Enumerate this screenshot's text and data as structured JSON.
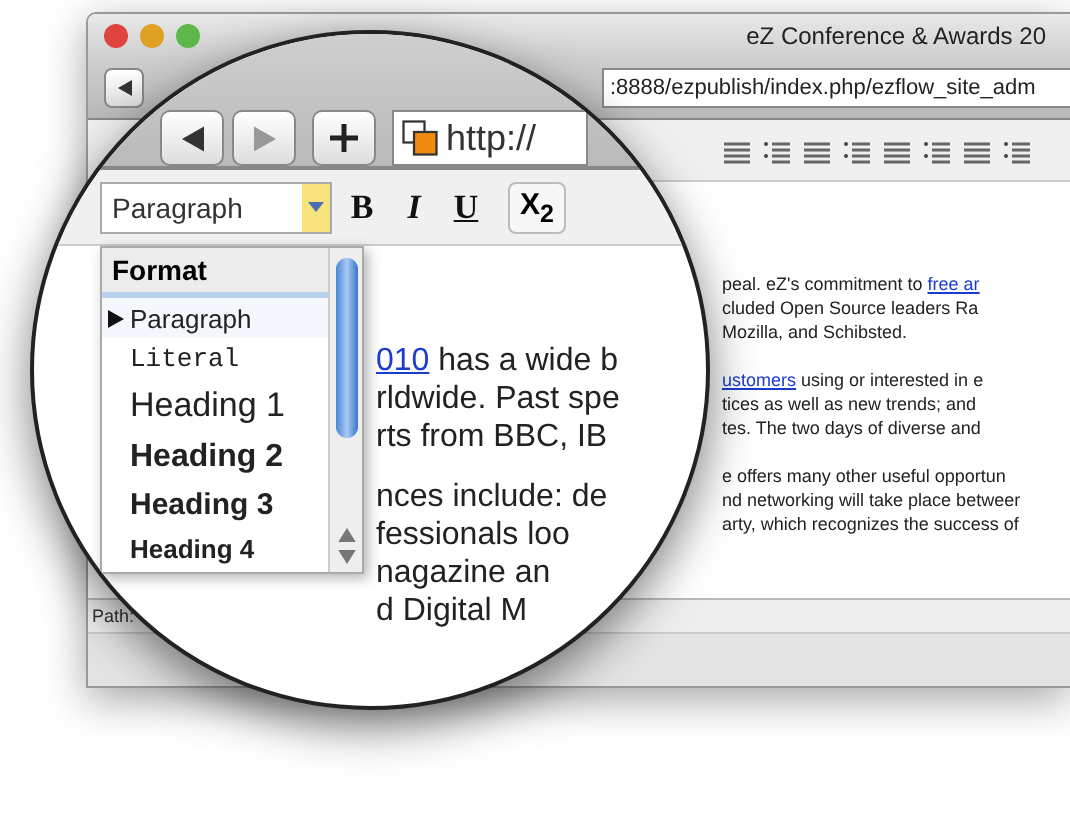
{
  "window": {
    "title": "eZ Conference & Awards 20"
  },
  "address_bar": {
    "value": ":8888/ezpublish/index.php/ezflow_site_adm"
  },
  "paragraphs": [
    {
      "lines": [
        {
          "parts": [
            {
              "text": "peal. eZ's commitment to ",
              "kind": "text"
            },
            {
              "text": "free ar",
              "kind": "link"
            }
          ]
        },
        {
          "parts": [
            {
              "text": "cluded Open Source leaders Ra",
              "kind": "text"
            }
          ]
        },
        {
          "parts": [
            {
              "text": "Mozilla, and Schibsted.",
              "kind": "text"
            }
          ]
        }
      ]
    },
    {
      "lines": [
        {
          "parts": [
            {
              "text": "ustomers",
              "kind": "link"
            },
            {
              "text": " using or interested in e",
              "kind": "text"
            }
          ]
        },
        {
          "parts": [
            {
              "text": "tices as well as new trends; and",
              "kind": "text"
            }
          ]
        },
        {
          "parts": [
            {
              "text": "tes. The two days of diverse and",
              "kind": "text"
            }
          ]
        }
      ]
    },
    {
      "lines": [
        {
          "parts": [
            {
              "text": "e offers many other useful opportun",
              "kind": "text"
            }
          ]
        },
        {
          "parts": [
            {
              "text": "nd networking will take place betweer",
              "kind": "text"
            }
          ]
        },
        {
          "parts": [
            {
              "text": "arty, which recognizes the success of",
              "kind": "text"
            }
          ]
        }
      ]
    }
  ],
  "path_bar": {
    "label": "Path:"
  },
  "magnifier": {
    "address": "http://",
    "format_select": {
      "value": "Paragraph"
    },
    "format_buttons": [
      "B",
      "I",
      "U"
    ],
    "subscript_button": "X$_{2}$",
    "dropdown": {
      "header": "Format",
      "items": [
        {
          "label": "Paragraph",
          "kind": "paragraph",
          "selected": true
        },
        {
          "label": "Literal",
          "kind": "literal",
          "selected": false
        },
        {
          "label": "Heading 1",
          "kind": "h1",
          "selected": false
        },
        {
          "label": "Heading 2",
          "kind": "h2",
          "selected": false
        },
        {
          "label": "Heading 3",
          "kind": "h3",
          "selected": false
        },
        {
          "label": "Heading 4",
          "kind": "h4",
          "selected": false
        }
      ]
    },
    "paragraphs": [
      {
        "lines": [
          {
            "parts": [
              {
                "text": "010",
                "kind": "link"
              },
              {
                "text": " has a wide b",
                "kind": "text"
              }
            ]
          },
          {
            "parts": [
              {
                "text": "rldwide. Past spe",
                "kind": "text"
              }
            ]
          },
          {
            "parts": [
              {
                "text": "rts from BBC, IB",
                "kind": "text"
              }
            ]
          }
        ]
      },
      {
        "lines": [
          {
            "parts": [
              {
                "text": "nces include: de",
                "kind": "text"
              }
            ]
          },
          {
            "parts": [
              {
                "text": "fessionals loo",
                "kind": "text"
              }
            ]
          },
          {
            "parts": [
              {
                "text": "nagazine an",
                "kind": "text"
              }
            ]
          },
          {
            "parts": [
              {
                "text": "d Digital M",
                "kind": "text"
              }
            ]
          }
        ]
      }
    ]
  }
}
